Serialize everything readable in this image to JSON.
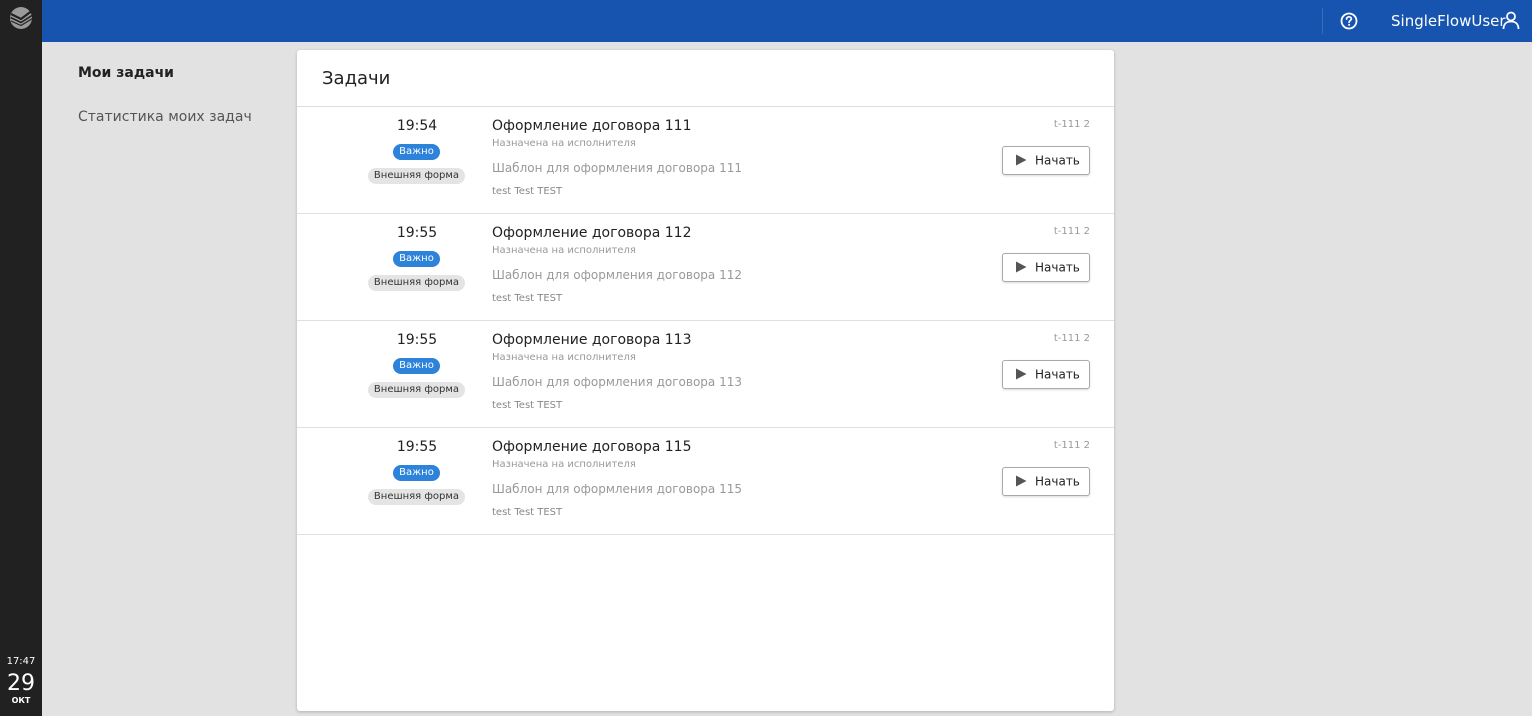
{
  "rail": {
    "clock_time": "17:47",
    "clock_day": "29",
    "clock_month": "ОКТ"
  },
  "topbar": {
    "user_name": "SingleFlowUser",
    "brand_color": "#1654b0"
  },
  "nav": {
    "items": [
      {
        "label": "Мои задачи",
        "active": true
      },
      {
        "label": "Статистика моих задач",
        "active": false
      }
    ]
  },
  "card": {
    "title": "Задачи"
  },
  "tasks": [
    {
      "time": "19:54",
      "priority": "Важно",
      "form": "Внешняя форма",
      "title": "Оформление договора 111",
      "status": "Назначена на исполнителя",
      "description": "Шаблон для оформления договора 111",
      "user": "test Test TEST",
      "code": "t-111 2",
      "action": "Начать"
    },
    {
      "time": "19:55",
      "priority": "Важно",
      "form": "Внешняя форма",
      "title": "Оформление договора 112",
      "status": "Назначена на исполнителя",
      "description": "Шаблон для оформления договора 112",
      "user": "test Test TEST",
      "code": "t-111 2",
      "action": "Начать"
    },
    {
      "time": "19:55",
      "priority": "Важно",
      "form": "Внешняя форма",
      "title": "Оформление договора 113",
      "status": "Назначена на исполнителя",
      "description": "Шаблон для оформления договора 113",
      "user": "test Test TEST",
      "code": "t-111 2",
      "action": "Начать"
    },
    {
      "time": "19:55",
      "priority": "Важно",
      "form": "Внешняя форма",
      "title": "Оформление договора 115",
      "status": "Назначена на исполнителя",
      "description": "Шаблон для оформления договора 115",
      "user": "test Test TEST",
      "code": "t-111 2",
      "action": "Начать"
    }
  ],
  "icons": {
    "logo": "sber-logo-icon",
    "help": "help-circle-icon",
    "user": "user-icon",
    "start": "play-icon"
  }
}
